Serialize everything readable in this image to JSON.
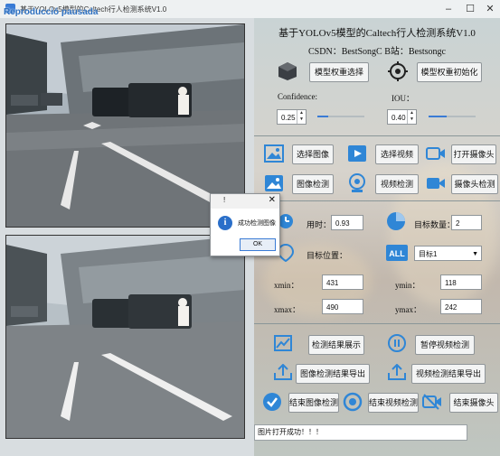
{
  "window": {
    "title": "基于YOLOv5模型的Caltech行人检测系统V1.0",
    "overlay_text": "Reproducció pausada"
  },
  "app": {
    "title": "基于YOLOv5模型的Caltech行人检测系统V1.0",
    "credits": "CSDN：BestSongC   B站：Bestsongc"
  },
  "model": {
    "select_label": "模型权重选择",
    "init_label": "模型权重初始化"
  },
  "params": {
    "confidence_label": "Confidence:",
    "confidence_value": "0.25",
    "iou_label": "IOU：",
    "iou_value": "0.40"
  },
  "controls": {
    "select_image": "选择图像",
    "select_video": "选择视频",
    "open_camera": "打开摄像头",
    "image_detect": "图像检测",
    "video_detect": "视频检测",
    "camera_detect": "摄像头检测"
  },
  "results": {
    "time_label": "用时：",
    "time_value": "0.93",
    "target_count_label": "目标数量：",
    "target_count_value": "2",
    "target_pos_label": "目标位置：",
    "target_select_value": "目标1",
    "xmin_label": "xmin：",
    "xmin_value": "431",
    "ymin_label": "ymin：",
    "ymin_value": "118",
    "xmax_label": "xmax：",
    "xmax_value": "490",
    "ymax_label": "ymax：",
    "ymax_value": "242"
  },
  "actions": {
    "show_results": "检测结果展示",
    "pause_video": "暂停视频检测",
    "export_image": "图像检测结果导出",
    "export_video": "视频检测结果导出",
    "end_image": "结束图像检测",
    "end_video": "结束视频检测",
    "end_camera": "结束摄像头"
  },
  "dialog": {
    "title": "!",
    "message": "成功检测图像",
    "ok_label": "OK"
  },
  "status": {
    "message": "图片打开成功！！！"
  },
  "colors": {
    "accent": "#2a6fc9",
    "icon_blue": "#2f86d6",
    "divider": "#8a9698"
  }
}
